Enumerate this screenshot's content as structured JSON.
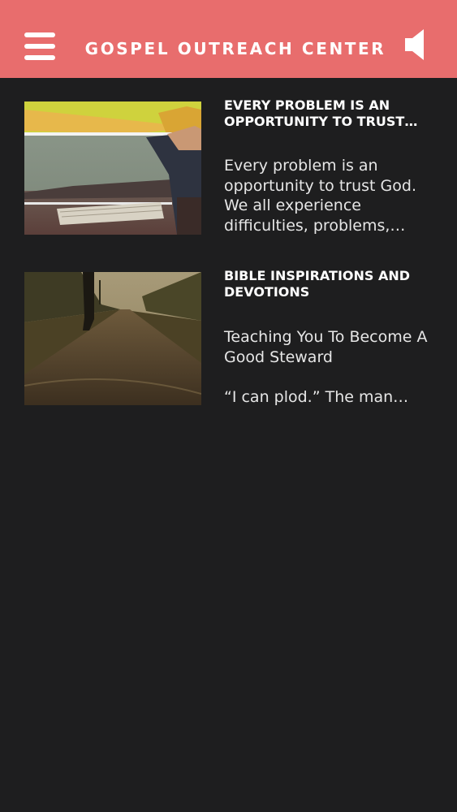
{
  "header": {
    "title": "GOSPEL OUTREACH CENTER",
    "background": "#e86d6d",
    "menu_icon": "hamburger-menu-icon",
    "speaker_icon": "speaker-icon"
  },
  "articles": [
    {
      "title": "EVERY PROBLEM IS AN OPPORTUNITY TO TRUST…",
      "excerpt": "Every problem is an opportunity to trust God. We all experience difficulties, problems,…",
      "thumbnail": "person-holding-bible-image"
    },
    {
      "title": "BIBLE INSPIRATIONS AND DEVOTIONS",
      "excerpt": "Teaching You To Become A Good Steward\n\n“I can plod.” The man…",
      "thumbnail": "country-road-walker-image"
    }
  ]
}
